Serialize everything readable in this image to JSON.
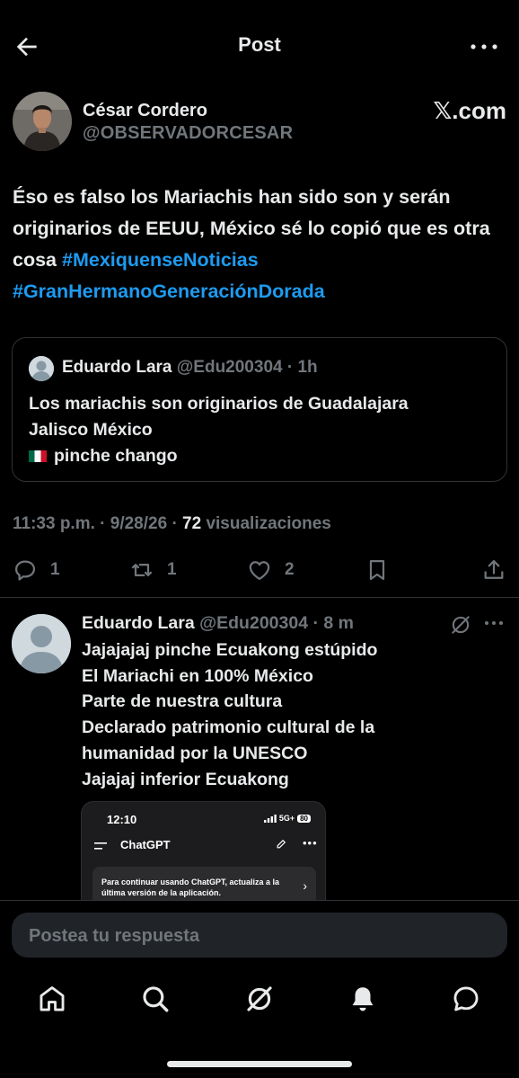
{
  "header": {
    "title": "Post"
  },
  "post": {
    "author_name": "César Cordero",
    "author_handle": "@OBSERVADORCESAR",
    "watermark": "𝕏.com",
    "text_plain": "Éso es falso los Mariachis han sido son y serán originarios de EEUU, México sé lo copió que es otra cosa",
    "hashtags": [
      "#MexiquenseNoticias",
      "#GranHermanoGeneraciónDorada"
    ],
    "quote": {
      "name": "Eduardo Lara",
      "handle_time": "@Edu200304 · 1h",
      "line1": "Los mariachis son originarios de Guadalajara",
      "line2": "Jalisco México",
      "line3": "pinche chango"
    },
    "meta_time": "11:33 p.m. · 9/28/26 · ",
    "meta_views": "72",
    "meta_views_label": " visualizaciones",
    "stats": {
      "replies": "1",
      "reposts": "1",
      "likes": "2"
    }
  },
  "reply": {
    "name": "Eduardo Lara",
    "handle_time": "@Edu200304 · 8 m",
    "lines": [
      "Jajajajaj pinche Ecuakong estúpido",
      "El Mariachi en 100% México",
      "Parte de nuestra cultura",
      "Declarado patrimonio cultural de la",
      "humanidad por la UNESCO",
      "Jajajaj inferior Ecuakong"
    ],
    "screenshot": {
      "time": "12:10",
      "network": "5G+",
      "battery": "80",
      "app_title": "ChatGPT",
      "banner_text": "Para continuar usando ChatGPT, actualiza a la última versión de la aplicación."
    }
  },
  "compose": {
    "placeholder": "Postea tu respuesta"
  },
  "colors": {
    "background": "#000000",
    "text": "#e7e9ea",
    "muted": "#71767b",
    "accent": "#1d9bf0",
    "divider": "#2f3336"
  },
  "icons": [
    "back-arrow-icon",
    "more-icon",
    "reply-icon",
    "repost-icon",
    "like-icon",
    "bookmark-icon",
    "share-icon",
    "grok-icon",
    "home-icon",
    "search-icon",
    "notifications-icon",
    "messages-icon"
  ]
}
